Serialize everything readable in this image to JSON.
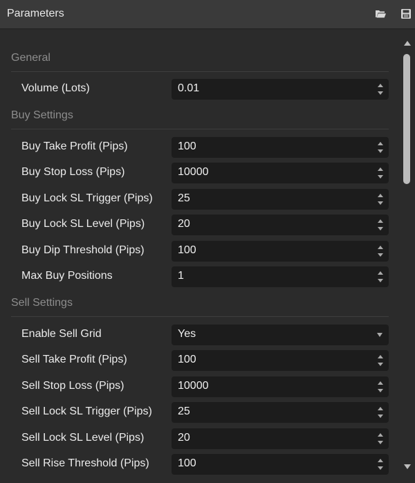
{
  "window": {
    "title": "Parameters",
    "icons": [
      "folder-open-icon",
      "save-icon"
    ]
  },
  "sections": {
    "general": "General",
    "buy": "Buy Settings",
    "sell": "Sell Settings"
  },
  "general": {
    "volume": {
      "label": "Volume (Lots)",
      "value": "0.01"
    }
  },
  "buy": {
    "take_profit": {
      "label": "Buy Take Profit (Pips)",
      "value": "100"
    },
    "stop_loss": {
      "label": "Buy Stop Loss (Pips)",
      "value": "10000"
    },
    "lock_sl_trigger": {
      "label": "Buy Lock SL Trigger (Pips)",
      "value": "25"
    },
    "lock_sl_level": {
      "label": "Buy Lock SL Level (Pips)",
      "value": "20"
    },
    "dip_threshold": {
      "label": "Buy Dip Threshold (Pips)",
      "value": "100"
    },
    "max_positions": {
      "label": "Max Buy Positions",
      "value": "1"
    }
  },
  "sell": {
    "enable_grid": {
      "label": "Enable Sell Grid",
      "value": "Yes"
    },
    "take_profit": {
      "label": "Sell Take Profit (Pips)",
      "value": "100"
    },
    "stop_loss": {
      "label": "Sell Stop Loss (Pips)",
      "value": "10000"
    },
    "lock_sl_trigger": {
      "label": "Sell Lock SL Trigger (Pips)",
      "value": "25"
    },
    "lock_sl_level": {
      "label": "Sell Lock SL Level (Pips)",
      "value": "20"
    },
    "rise_threshold": {
      "label": "Sell Rise Threshold (Pips)",
      "value": "100"
    }
  },
  "colors": {
    "titlebar": "#3a3a3a",
    "panel": "#2b2b2b",
    "field": "#1c1c1c",
    "section_text": "#8d8d8d",
    "label_text": "#ececec"
  }
}
